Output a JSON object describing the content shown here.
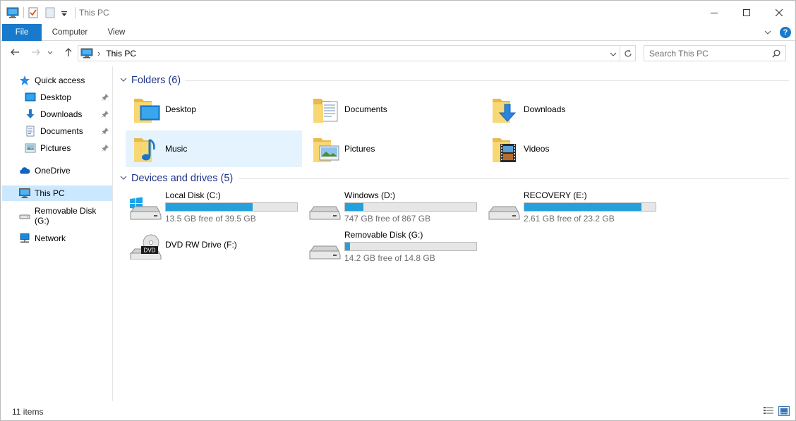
{
  "window": {
    "title": "This PC"
  },
  "ribbon": {
    "tabs": [
      {
        "label": "File"
      },
      {
        "label": "Computer"
      },
      {
        "label": "View"
      }
    ],
    "help": "?"
  },
  "address": {
    "path_label": "This PC",
    "separator": "›"
  },
  "search": {
    "placeholder": "Search This PC"
  },
  "sidebar": {
    "quick_access": "Quick access",
    "pinned": [
      {
        "label": "Desktop",
        "icon": "desktop-icon"
      },
      {
        "label": "Downloads",
        "icon": "downloads-icon"
      },
      {
        "label": "Documents",
        "icon": "documents-icon"
      },
      {
        "label": "Pictures",
        "icon": "pictures-icon"
      }
    ],
    "onedrive": "OneDrive",
    "this_pc": "This PC",
    "removable": "Removable Disk (G:)",
    "network": "Network"
  },
  "folders": {
    "header": "Folders (6)",
    "items": [
      {
        "label": "Desktop",
        "icon": "desktop-folder-icon"
      },
      {
        "label": "Documents",
        "icon": "documents-folder-icon"
      },
      {
        "label": "Downloads",
        "icon": "downloads-folder-icon"
      },
      {
        "label": "Music",
        "icon": "music-folder-icon",
        "selected": true
      },
      {
        "label": "Pictures",
        "icon": "pictures-folder-icon"
      },
      {
        "label": "Videos",
        "icon": "videos-folder-icon"
      }
    ]
  },
  "drives": {
    "header": "Devices and drives (5)",
    "items": [
      {
        "name": "Local Disk (C:)",
        "free": "13.5 GB free of 39.5 GB",
        "used_fraction": 0.66,
        "icon": "windows-drive-icon"
      },
      {
        "name": "Windows (D:)",
        "free": "747 GB free of 867 GB",
        "used_fraction": 0.14,
        "icon": "hard-drive-icon"
      },
      {
        "name": "RECOVERY (E:)",
        "free": "2.61 GB free of 23.2 GB",
        "used_fraction": 0.89,
        "icon": "hard-drive-icon"
      },
      {
        "name": "DVD RW Drive (F:)",
        "icon": "dvd-drive-icon",
        "dvd_text": "DVD"
      },
      {
        "name": "Removable Disk (G:)",
        "free": "14.2 GB free of 14.8 GB",
        "used_fraction": 0.04,
        "icon": "removable-drive-icon"
      }
    ]
  },
  "status": {
    "items": "11 items"
  },
  "colors": {
    "accent": "#1979ca",
    "bar_fill": "#26a0da",
    "group_header": "#1e3287",
    "selection": "#cce8ff"
  }
}
